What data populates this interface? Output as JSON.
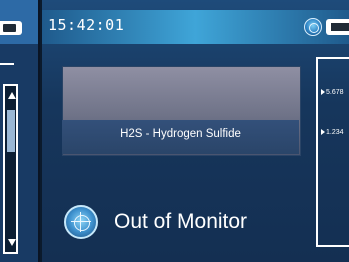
{
  "header": {
    "time": "15:42:01"
  },
  "gas": {
    "name": "H2S - Hydrogen Sulfide"
  },
  "monitor": {
    "status_label": "Out of Monitor"
  },
  "scale": {
    "ticks": [
      "5.678",
      "1.234"
    ]
  },
  "icons": {
    "status": "radar-icon",
    "battery": "battery-icon",
    "monitor": "radar-icon",
    "scroll_up": "triangle-up-icon",
    "scroll_down": "triangle-down-icon"
  },
  "colors": {
    "header_accent": "#3fa5d8",
    "panel_bg": "#16365c",
    "text": "#ffffff"
  }
}
